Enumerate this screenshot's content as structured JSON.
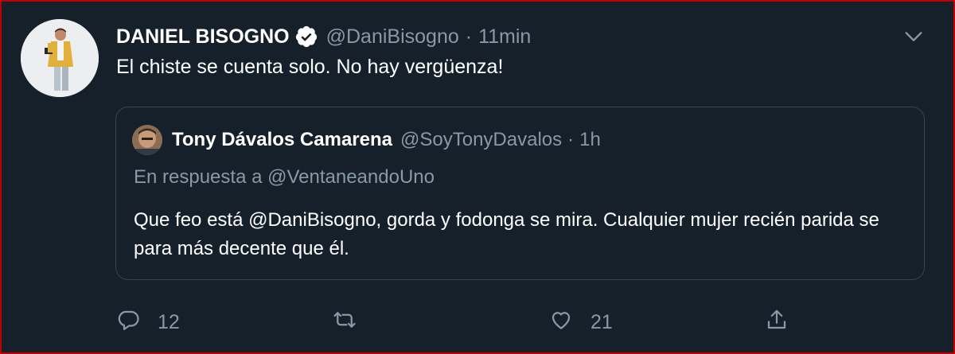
{
  "tweet": {
    "author_name": "DANIEL BISOGNO",
    "author_handle": "@DaniBisogno",
    "separator": "·",
    "time": "11min",
    "text": "El chiste se cuenta solo. No hay vergüenza!"
  },
  "quoted_tweet": {
    "author_name": "Tony Dávalos Camarena",
    "author_handle": "@SoyTonyDavalos",
    "separator": "·",
    "time": "1h",
    "reply_to": "En respuesta a @VentaneandoUno",
    "text": "Que feo está @DaniBisogno, gorda y fodonga se mira. Cualquier mujer recién parida se para más decente que él."
  },
  "actions": {
    "reply_count": "12",
    "retweet_count": "",
    "like_count": "21"
  },
  "colors": {
    "background": "#15202b",
    "text_primary": "#ffffff",
    "text_secondary": "#8899a6",
    "verified": "#ffffff",
    "border": "#38444d"
  },
  "icons": [
    "verified-badge-icon",
    "chevron-down-icon",
    "reply-icon",
    "retweet-icon",
    "like-icon",
    "share-icon"
  ]
}
